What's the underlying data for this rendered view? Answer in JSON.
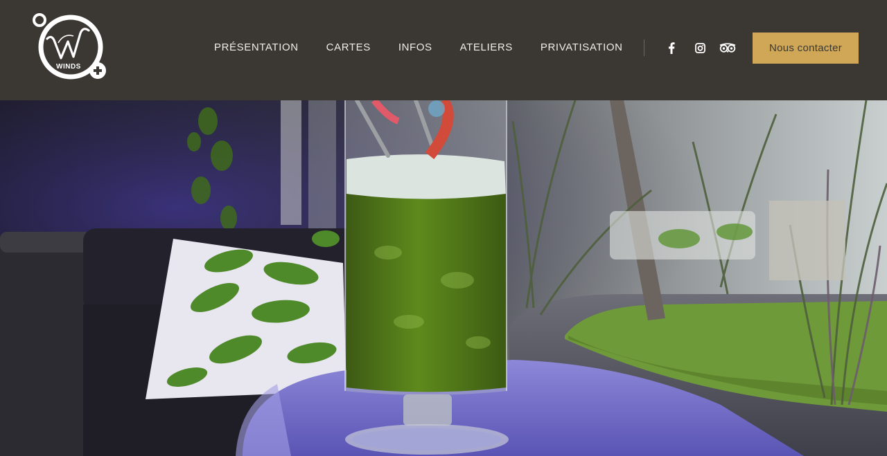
{
  "brand": {
    "logo_text": "WINDS",
    "logo_initial": "W",
    "accent_color": "#d0a756",
    "header_bg": "#3b3834"
  },
  "nav": {
    "items": [
      {
        "label": "PRÉSENTATION"
      },
      {
        "label": "CARTES"
      },
      {
        "label": "INFOS"
      },
      {
        "label": "ATELIERS"
      },
      {
        "label": "PRIVATISATION"
      }
    ]
  },
  "social": {
    "icons": [
      "facebook-icon",
      "instagram-icon",
      "tripadvisor-icon"
    ]
  },
  "cta": {
    "label": "Nous contacter"
  },
  "hero": {
    "subject": "green cocktail in tall glass on terrace table"
  }
}
